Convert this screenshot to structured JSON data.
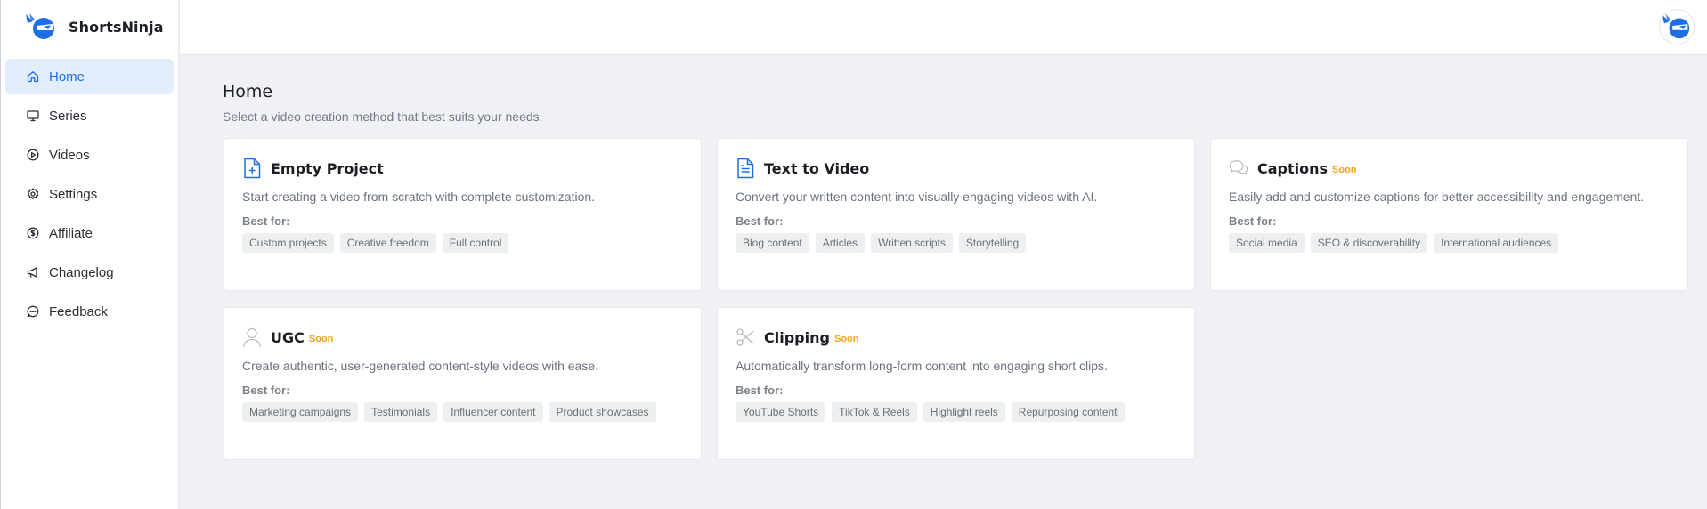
{
  "app": {
    "name": "ShortsNinja"
  },
  "sidebar": {
    "items": [
      {
        "label": "Home",
        "icon": "home-icon",
        "active": true
      },
      {
        "label": "Series",
        "icon": "monitor-icon"
      },
      {
        "label": "Videos",
        "icon": "play-circle-icon"
      },
      {
        "label": "Settings",
        "icon": "gear-icon"
      },
      {
        "label": "Affiliate",
        "icon": "dollar-circle-icon"
      },
      {
        "label": "Changelog",
        "icon": "megaphone-icon"
      },
      {
        "label": "Feedback",
        "icon": "chat-bubble-icon"
      }
    ]
  },
  "header": {
    "avatar_icon": "ninja-avatar-icon"
  },
  "main": {
    "title": "Home",
    "subtitle": "Select a video creation method that best suits your needs.",
    "best_for_label": "Best for:",
    "soon_label": "Soon",
    "accent_color": "#1e6ee6",
    "soon_color": "#f0a31b",
    "cards": [
      {
        "title": "Empty Project",
        "icon": "file-plus-icon",
        "soon": false,
        "description": "Start creating a video from scratch with complete customization.",
        "tags": [
          "Custom projects",
          "Creative freedom",
          "Full control"
        ]
      },
      {
        "title": "Text to Video",
        "icon": "file-text-icon",
        "soon": false,
        "description": "Convert your written content into visually engaging videos with AI.",
        "tags": [
          "Blog content",
          "Articles",
          "Written scripts",
          "Storytelling"
        ]
      },
      {
        "title": "Captions",
        "icon": "chat-bubbles-icon",
        "soon": true,
        "description": "Easily add and customize captions for better accessibility and engagement.",
        "tags": [
          "Social media",
          "SEO & discoverability",
          "International audiences"
        ]
      },
      {
        "title": "UGC",
        "icon": "user-icon",
        "soon": true,
        "description": "Create authentic, user-generated content-style videos with ease.",
        "tags": [
          "Marketing campaigns",
          "Testimonials",
          "Influencer content",
          "Product showcases"
        ]
      },
      {
        "title": "Clipping",
        "icon": "scissors-icon",
        "soon": true,
        "description": "Automatically transform long-form content into engaging short clips.",
        "tags": [
          "YouTube Shorts",
          "TikTok & Reels",
          "Highlight reels",
          "Repurposing content"
        ]
      }
    ]
  }
}
